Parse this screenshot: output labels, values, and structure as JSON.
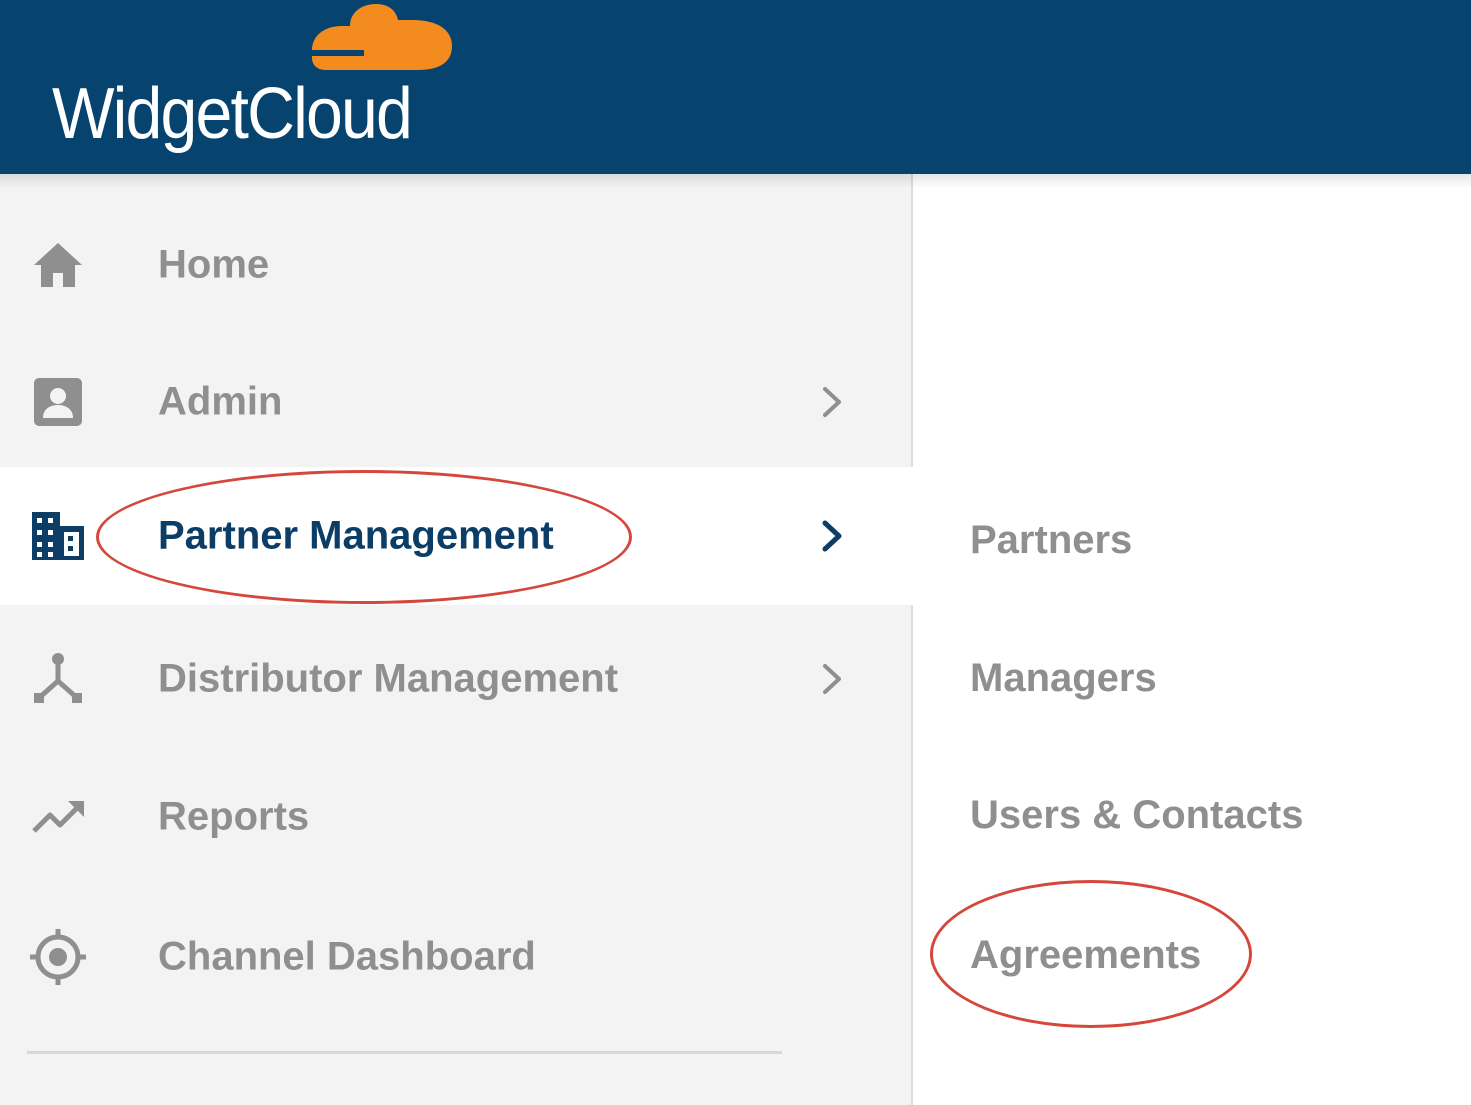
{
  "brand": {
    "name": "WidgetCloud",
    "header_color": "#06436f",
    "cloud_color": "#f48b1f"
  },
  "sidebar": {
    "items": [
      {
        "label": "Home",
        "icon": "home-icon"
      },
      {
        "label": "Admin",
        "icon": "contact-card-icon",
        "has_submenu": true
      },
      {
        "label": "Partner Management",
        "icon": "building-icon",
        "has_submenu": true,
        "active": true
      },
      {
        "label": "Distributor Management",
        "icon": "distribution-icon",
        "has_submenu": true
      },
      {
        "label": "Reports",
        "icon": "trending-up-icon"
      },
      {
        "label": "Channel Dashboard",
        "icon": "target-icon"
      }
    ]
  },
  "submenu": {
    "items": [
      {
        "label": "Partners"
      },
      {
        "label": "Managers"
      },
      {
        "label": "Users & Contacts"
      },
      {
        "label": "Agreements"
      }
    ]
  },
  "colors": {
    "active_text": "#0b3d66",
    "inactive_text": "#8f8f8f",
    "sidebar_bg": "#f3f3f3",
    "annotation_ring": "#d5473b"
  }
}
